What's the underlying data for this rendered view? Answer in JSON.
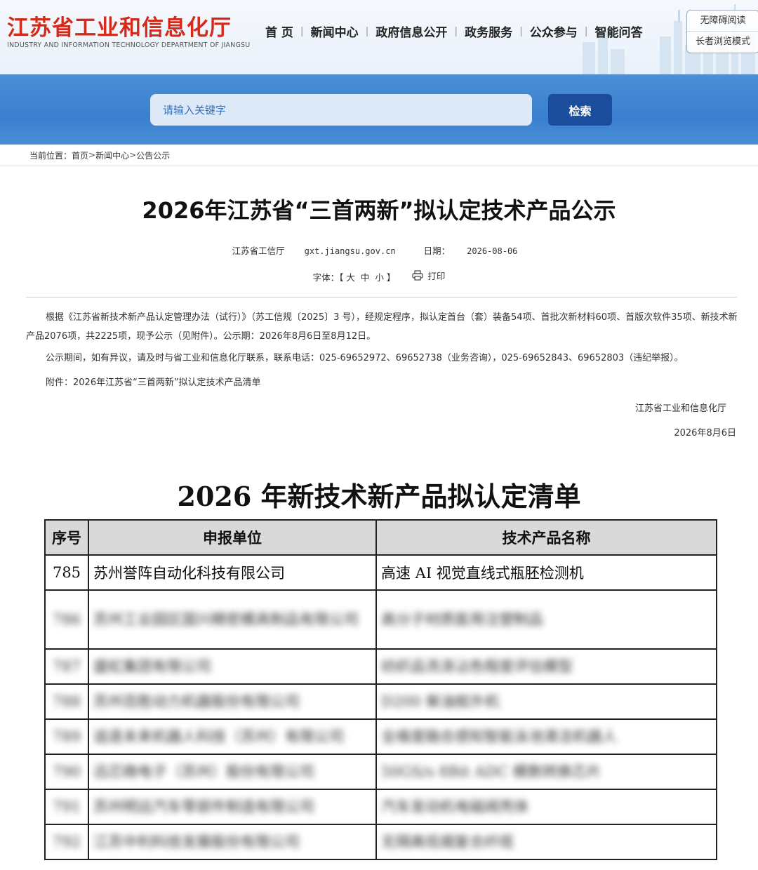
{
  "header": {
    "logo_cn": "江苏省工业和信息化厅",
    "logo_en": "INDUSTRY AND INFORMATION TECHNOLOGY DEPARTMENT OF JIANGSU",
    "nav": [
      "首 页",
      "新闻中心",
      "政府信息公开",
      "政务服务",
      "公众参与",
      "智能问答"
    ],
    "accessibility": "无障碍阅读",
    "elder_mode": "长者浏览模式"
  },
  "search": {
    "placeholder": "请输入关键字",
    "button": "检索"
  },
  "breadcrumb": {
    "prefix": "当前位置：",
    "items": [
      "首页",
      "新闻中心",
      "公告公示"
    ],
    "separator": ">"
  },
  "article": {
    "title": "2026年江苏省“三首两新”拟认定技术产品公示",
    "source": "江苏省工信厅",
    "site": "gxt.jiangsu.gov.cn",
    "date_label": "日期：",
    "date": "2026-08-06",
    "font_label": "字体：【",
    "font_sizes": [
      "大",
      "中",
      "小"
    ],
    "font_close": "】",
    "print_label": "打印",
    "paragraphs": [
      "根据《江苏省新技术新产品认定管理办法（试行）》（苏工信规〔2025〕3 号），经规定程序，拟认定首台（套）装备54项、首批次新材料60项、首版次软件35项、新技术新产品2076项，共2225项，现予公示（见附件）。公示期：2026年8月6日至8月12日。",
      "公示期间，如有异议，请及时与省工业和信息化厅联系，联系电话：025-69652972、69652738（业务咨询），025-69652843、69652803（违纪举报）。",
      "附件：2026年江苏省“三首两新”拟认定技术产品清单"
    ],
    "sign_org": "江苏省工业和信息化厅",
    "sign_date": "2026年8月6日"
  },
  "attachment": {
    "title": "2026 年新技术新产品拟认定清单",
    "headers": [
      "序号",
      "申报单位",
      "技术产品名称"
    ],
    "clear_row": {
      "no": "785",
      "org": "苏州誉阵自动化科技有限公司",
      "product": "高速 AI 视觉直线式瓶胚检测机"
    },
    "blurred_rows": [
      {
        "no": "786",
        "org": "苏州工业园区国兴精密模具制品有限公司",
        "product": "高分子材质医用注塑制品",
        "tall": true
      },
      {
        "no": "787",
        "org": "盛虹集团有限公司",
        "product": "纺织品洗涤沾色程度评估模型",
        "tall": false
      },
      {
        "no": "788",
        "org": "苏州百胜动力机器股份有限公司",
        "product": "D200 柴油舷外机",
        "tall": false
      },
      {
        "no": "789",
        "org": "追逐未来机器人科技（苏州）有限公司",
        "product": "全维度融合感知智能泳池清洁机器人",
        "tall": false
      },
      {
        "no": "790",
        "org": "迅芯微电子（苏州）股份有限公司",
        "product": "50GS/s 8Bit ADC 模数转换芯片",
        "tall": false
      },
      {
        "no": "791",
        "org": "苏州明远汽车零部件制造有限公司",
        "product": "汽车发动机电磁阀壳体",
        "tall": false
      },
      {
        "no": "792",
        "org": "江苏中利科技发展股份有限公司",
        "product": "无隔离低烟复合纤缆",
        "tall": false
      }
    ]
  },
  "colors": {
    "logo_red": "#d42a1c",
    "search_band_blue": "#3a7fcf",
    "search_button": "#1b4d9c",
    "table_header_bg": "#d9d9d9"
  }
}
